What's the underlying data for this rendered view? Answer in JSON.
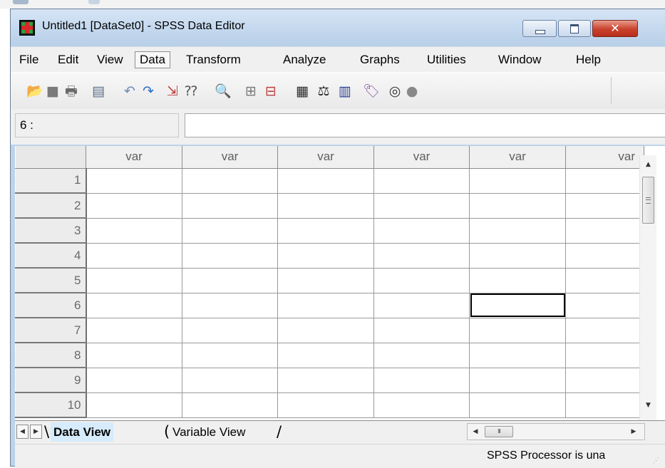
{
  "window": {
    "title": "Untitled1 [DataSet0] - SPSS Data Editor",
    "close_glyph": "✕"
  },
  "menu": {
    "items": [
      {
        "label": "File",
        "active": false
      },
      {
        "label": "Edit",
        "active": false
      },
      {
        "label": "View",
        "active": false
      },
      {
        "label": "Data",
        "active": true
      },
      {
        "label": "Transform",
        "active": false
      },
      {
        "label": "Analyze",
        "active": false
      },
      {
        "label": "Graphs",
        "active": false
      },
      {
        "label": "Utilities",
        "active": false
      },
      {
        "label": "Window",
        "active": false
      },
      {
        "label": "Help",
        "active": false
      }
    ]
  },
  "toolbar": {
    "icons": [
      {
        "name": "open-folder-icon",
        "glyph": "📂",
        "color": "#d9a928"
      },
      {
        "name": "save-icon",
        "glyph": "■",
        "color": "#7a7a7a"
      },
      {
        "name": "print-icon",
        "glyph": "🖶",
        "color": "#6a6a6a"
      },
      {
        "name": "dialog-recall-icon",
        "glyph": "▤",
        "color": "#5a6a8a"
      },
      {
        "name": "undo-icon",
        "glyph": "↶",
        "color": "#6c8fb8"
      },
      {
        "name": "redo-icon",
        "glyph": "↷",
        "color": "#2c6fc8"
      },
      {
        "name": "goto-case-icon",
        "glyph": "⇲",
        "color": "#c04040"
      },
      {
        "name": "variables-icon",
        "glyph": "⁇",
        "color": "#555555"
      },
      {
        "name": "find-icon",
        "glyph": "🔍",
        "color": "#444444"
      },
      {
        "name": "insert-cases-icon",
        "glyph": "⊞",
        "color": "#7a7a7a"
      },
      {
        "name": "insert-variable-icon",
        "glyph": "⊟",
        "color": "#c04040"
      },
      {
        "name": "split-file-icon",
        "glyph": "▦",
        "color": "#2a2a2a"
      },
      {
        "name": "weight-cases-icon",
        "glyph": "⚖",
        "color": "#2a2a2a"
      },
      {
        "name": "select-cases-icon",
        "glyph": "▥",
        "color": "#2a3f8f"
      },
      {
        "name": "value-labels-icon",
        "glyph": "🏷",
        "color": "#8a5aa8"
      },
      {
        "name": "use-sets-icon",
        "glyph": "◎",
        "color": "#333333"
      },
      {
        "name": "show-all-variables-icon",
        "glyph": "●",
        "color": "#888888"
      }
    ]
  },
  "cellbar": {
    "cell_reference": "6 :",
    "cell_value": ""
  },
  "grid": {
    "columns": [
      "var",
      "var",
      "var",
      "var",
      "var",
      "var"
    ],
    "rows": [
      "1",
      "2",
      "3",
      "4",
      "5",
      "6",
      "7",
      "8",
      "9",
      "10"
    ],
    "selected": {
      "row": 6,
      "column": 5
    }
  },
  "tabs": {
    "items": [
      {
        "label": "Data View",
        "active": true
      },
      {
        "label": "Variable View",
        "active": false
      }
    ],
    "nav_prev": "◀",
    "nav_next": "▶"
  },
  "scrollbars": {
    "up_arrow": "▲",
    "down_arrow": "▼",
    "left_arrow": "◀",
    "right_arrow": "▶",
    "thumb_grip": "III"
  },
  "status": {
    "text": "SPSS Processor is una"
  }
}
